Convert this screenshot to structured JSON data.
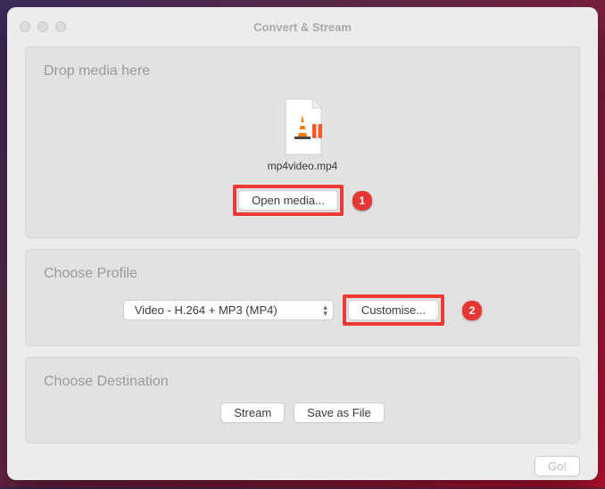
{
  "window": {
    "title": "Convert & Stream"
  },
  "drop": {
    "heading": "Drop media here",
    "filename": "mp4video.mp4",
    "open_label": "Open media..."
  },
  "profile": {
    "heading": "Choose Profile",
    "selected": "Video - H.264 + MP3 (MP4)",
    "customise_label": "Customise..."
  },
  "destination": {
    "heading": "Choose Destination",
    "stream_label": "Stream",
    "save_label": "Save as File"
  },
  "footer": {
    "go_label": "Go!"
  },
  "annotations": {
    "badge1": "1",
    "badge2": "2"
  }
}
